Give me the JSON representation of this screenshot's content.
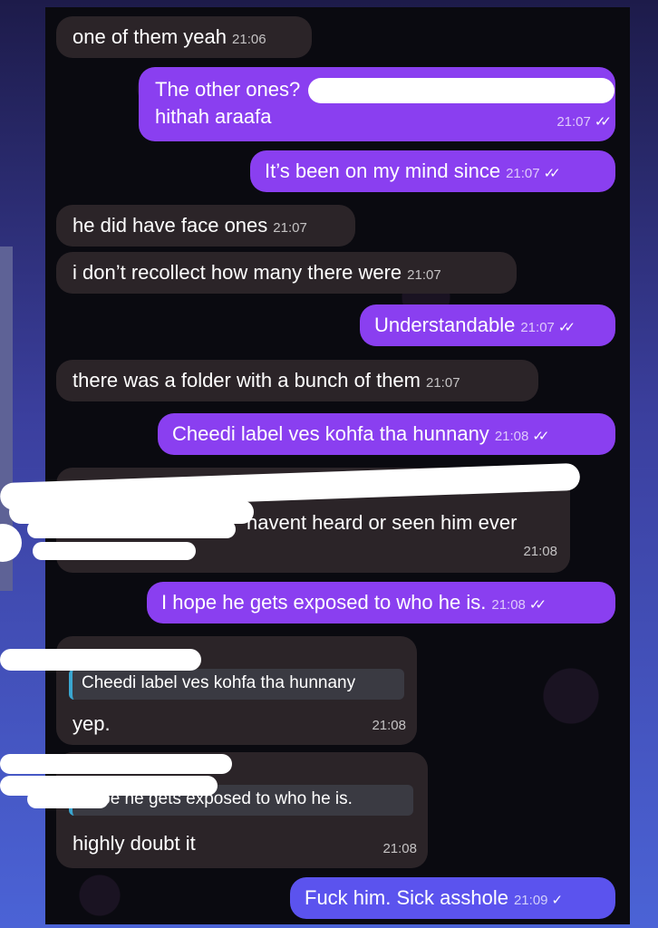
{
  "messages": [
    {
      "text": "one of them yeah",
      "time": "21:06"
    },
    {
      "line1": "The other ones?",
      "line2": "hithah araafa",
      "time": "21:07"
    },
    {
      "text": "It’s been on my mind since",
      "time": "21:07"
    },
    {
      "text": "he did have face ones",
      "time": "21:07"
    },
    {
      "text": "i don’t recollect how many there were",
      "time": "21:07"
    },
    {
      "text": "Understandable",
      "time": "21:07"
    },
    {
      "text": "there was a folder with a bunch of them",
      "time": "21:07"
    },
    {
      "text": "Cheedi label ves kohfa tha hunnany",
      "time": "21:08"
    },
    {
      "text": "havent heard or seen him ever",
      "time": "21:08"
    },
    {
      "text": "I hope he gets exposed to who he is.",
      "time": "21:08"
    },
    {
      "reply": "Cheedi label ves kohfa tha hunnany",
      "text": "yep.",
      "time": "21:08"
    },
    {
      "reply": "hope he gets exposed to who he is.",
      "text": "highly doubt it",
      "time": "21:08"
    },
    {
      "text": "Fuck him. Sick asshole",
      "time": "21:09"
    }
  ],
  "ticks": "✓✓",
  "single_tick": "✓",
  "colors": {
    "incoming": "#2b2428",
    "outgoing": "#8a3ff0",
    "outgoing_last": "#5b53ee"
  }
}
